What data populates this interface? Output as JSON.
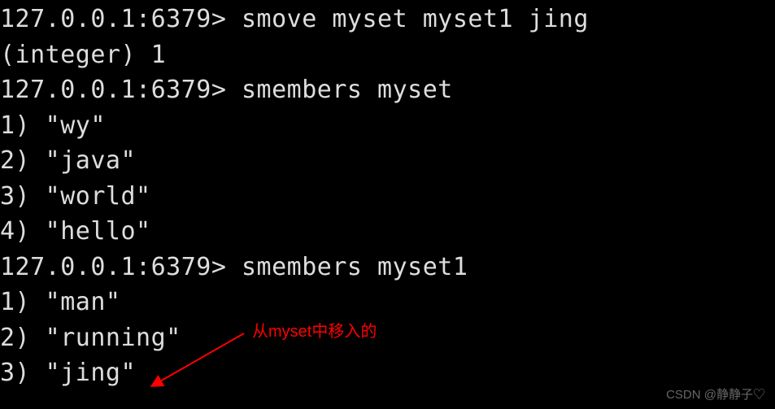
{
  "lines": {
    "l0": "127.0.0.1:6379> smove myset myset1 jing",
    "l1": "(integer) 1",
    "l2": "127.0.0.1:6379> smembers myset",
    "l3": "1) \"wy\"",
    "l4": "2) \"java\"",
    "l5": "3) \"world\"",
    "l6": "4) \"hello\"",
    "l7": "127.0.0.1:6379> smembers myset1",
    "l8": "1) \"man\"",
    "l9": "2) \"running\"",
    "l10": "3) \"jing\""
  },
  "annotation": "从myset中移入的",
  "watermark": "CSDN @静静子♡"
}
